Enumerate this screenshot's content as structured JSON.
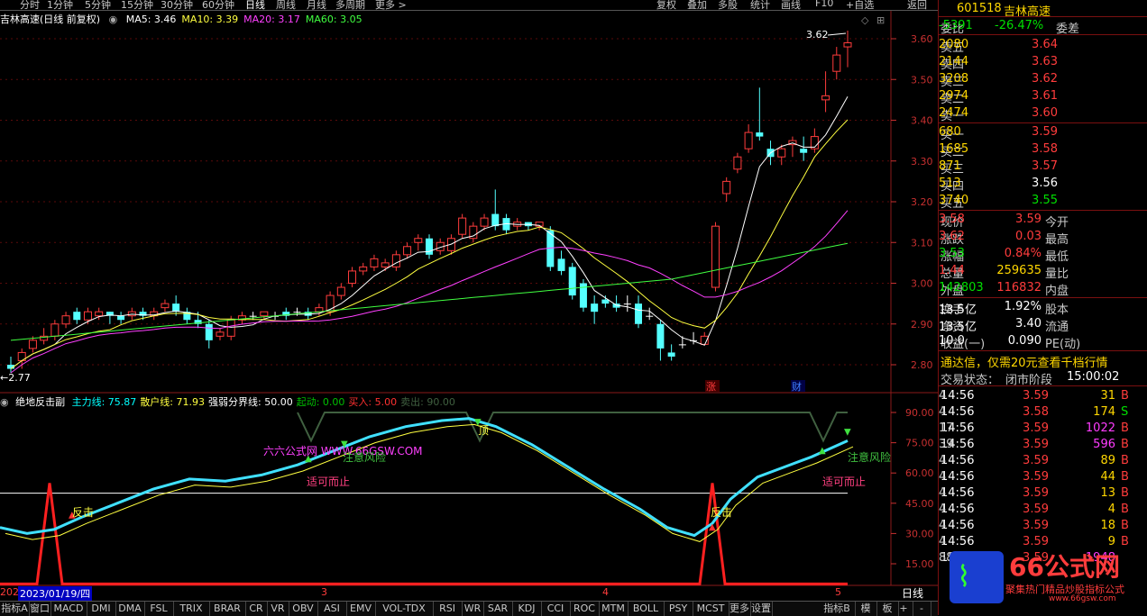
{
  "top_menu": {
    "items": [
      "分时",
      "1分钟",
      "5分钟",
      "15分钟",
      "30分钟",
      "60分钟",
      "日线",
      "周线",
      "月线",
      "多周期",
      "更多 >"
    ],
    "right_items": [
      "复权",
      "叠加",
      "多股",
      "统计",
      "画线",
      "F10",
      "+自选",
      "返回"
    ]
  },
  "main_chart": {
    "stock_label": "吉林高速(日线 前复权)",
    "ma_labels": [
      {
        "text": "MA5: 3.46",
        "color": "#ffffff"
      },
      {
        "text": "MA10: 3.39",
        "color": "#ffff40"
      },
      {
        "text": "MA20: 3.17",
        "color": "#ff40ff"
      },
      {
        "text": "MA60: 3.05",
        "color": "#40ff40"
      }
    ],
    "price_axis": [
      "3.60",
      "3.50",
      "3.40",
      "3.30",
      "3.20",
      "3.10",
      "3.00",
      "2.90",
      "2.80"
    ],
    "high_label": "3.62",
    "low_label": "2.77",
    "event_markers": [
      {
        "text": "涨"
      },
      {
        "text": "财"
      }
    ]
  },
  "sub_chart": {
    "name": "绝地反击副",
    "labels": [
      {
        "text": "主力线: 75.87",
        "color": "#00ffff"
      },
      {
        "text": "散户线: 71.93",
        "color": "#ffff40"
      },
      {
        "text": "强弱分界线: 50.00",
        "color": "#ffffff"
      },
      {
        "text": "起动: 0.00",
        "color": "#00c000"
      },
      {
        "text": "买入: 5.00",
        "color": "#ff3030"
      },
      {
        "text": "卖出: 90.00",
        "color": "#406040"
      }
    ],
    "axis": [
      "90.00",
      "75.00",
      "60.00",
      "45.00",
      "30.00",
      "15.00"
    ],
    "annotations": [
      {
        "text": "反击",
        "color": "#ffff40"
      },
      {
        "text": "反击",
        "color": "#ffff40"
      },
      {
        "text": "六六公式网 WWW.66GSW.COM",
        "color": "#ff40ff"
      },
      {
        "text": "注意风险",
        "color": "#40c040"
      },
      {
        "text": "注意风险",
        "color": "#40c040"
      },
      {
        "text": "适可而止",
        "color": "#ff4080"
      },
      {
        "text": "适可而止",
        "color": "#ff4080"
      },
      {
        "text": "顶",
        "color": "#ffff40"
      }
    ]
  },
  "date_bar": {
    "left_label": "202",
    "cursor_date": "2023/01/19/四",
    "month_marks": [
      "3",
      "4",
      "5"
    ]
  },
  "tab_bar": {
    "tabs": [
      "指标A",
      "窗口",
      "MACD",
      "DMI",
      "DMA",
      "FSL",
      "TRIX",
      "BRAR",
      "CR",
      "VR",
      "OBV",
      "ASI",
      "EMV",
      "VOL-TDX",
      "RSI",
      "WR",
      "SAR",
      "KDJ",
      "CCI",
      "ROC",
      "MTM",
      "BOLL",
      "PSY",
      "MCST",
      "更多",
      "设置"
    ],
    "right_tabs": [
      "指标B",
      "模",
      "板"
    ],
    "period": "日线"
  },
  "quote_panel": {
    "code": "601518",
    "name": "吉林高速",
    "weibi_label": "委比",
    "weibi": "-26.47%",
    "weicha_label": "委差",
    "weicha": "-5391",
    "asks": [
      {
        "label": "卖五",
        "price": "3.64",
        "vol": "2080"
      },
      {
        "label": "卖四",
        "price": "3.63",
        "vol": "2144"
      },
      {
        "label": "卖三",
        "price": "3.62",
        "vol": "3208"
      },
      {
        "label": "卖二",
        "price": "3.61",
        "vol": "2974"
      },
      {
        "label": "卖一",
        "price": "3.60",
        "vol": "2474"
      }
    ],
    "bids": [
      {
        "label": "买一",
        "price": "3.59",
        "vol": "680",
        "pcolor": "#ff3c3c"
      },
      {
        "label": "买二",
        "price": "3.58",
        "vol": "1685",
        "pcolor": "#ff3c3c"
      },
      {
        "label": "买三",
        "price": "3.57",
        "vol": "871",
        "pcolor": "#ff3c3c"
      },
      {
        "label": "买四",
        "price": "3.56",
        "vol": "513",
        "pcolor": "#ffffff"
      },
      {
        "label": "买五",
        "price": "3.55",
        "vol": "3740",
        "pcolor": "#00e000"
      }
    ],
    "stats": [
      {
        "l1": "现价",
        "v1": "3.59",
        "c1": "#ff3c3c",
        "l2": "今开",
        "v2": "3.58",
        "c2": "#ff3c3c"
      },
      {
        "l1": "涨跌",
        "v1": "0.03",
        "c1": "#ff3c3c",
        "l2": "最高",
        "v2": "3.62",
        "c2": "#ff3c3c"
      },
      {
        "l1": "涨幅",
        "v1": "0.84%",
        "c1": "#ff3c3c",
        "l2": "最低",
        "v2": "3.53",
        "c2": "#00e000"
      },
      {
        "l1": "总量",
        "v1": "259635",
        "c1": "#ffd700",
        "l2": "量比",
        "v2": "1.44",
        "c2": "#ff3c3c"
      },
      {
        "l1": "外盘",
        "v1": "116832",
        "c1": "#ff3c3c",
        "l2": "内盘",
        "v2": "142803",
        "c2": "#00e000"
      }
    ],
    "fin": [
      {
        "l1": "换手",
        "v1": "1.92%",
        "l2": "股本",
        "v2": "13.5亿"
      },
      {
        "l1": "净资",
        "v1": "3.40",
        "l2": "流通",
        "v2": "13.5亿"
      },
      {
        "l1": "收益(一)",
        "v1": "0.090",
        "l2": "PE(动)",
        "v2": "10.0"
      }
    ],
    "promo": "通达信，仅需20元查看千档行情",
    "trade_state_label": "交易状态：",
    "trade_state": "闭市阶段",
    "trade_time": "15:00:02",
    "ticks": [
      {
        "t": "14:56",
        "p": "3.59",
        "v": "31",
        "bs": "B",
        "n": "4"
      },
      {
        "t": "14:56",
        "p": "3.58",
        "v": "174",
        "bs": "S",
        "n": "4"
      },
      {
        "t": "14:56",
        "p": "3.59",
        "v": "1022",
        "bs": "B",
        "n": "17"
      },
      {
        "t": "14:56",
        "p": "3.59",
        "v": "596",
        "bs": "B",
        "n": "39"
      },
      {
        "t": "14:56",
        "p": "3.59",
        "v": "89",
        "bs": "B",
        "n": "4"
      },
      {
        "t": "14:56",
        "p": "3.59",
        "v": "44",
        "bs": "B",
        "n": "4"
      },
      {
        "t": "14:56",
        "p": "3.59",
        "v": "13",
        "bs": "B",
        "n": "4"
      },
      {
        "t": "14:56",
        "p": "3.59",
        "v": "4",
        "bs": "B",
        "n": "4"
      },
      {
        "t": "14:56",
        "p": "3.59",
        "v": "18",
        "bs": "B",
        "n": "4"
      },
      {
        "t": "14:56",
        "p": "3.59",
        "v": "9",
        "bs": "B",
        "n": "4"
      },
      {
        "t": "15:00",
        "p": "3.59",
        "v": "1948",
        "bs": "",
        "n": "88"
      }
    ],
    "logo_text": "66公式网",
    "logo_sub": "聚集热门精品炒股指标公式",
    "logo_url": "www.66gsw.com"
  }
}
